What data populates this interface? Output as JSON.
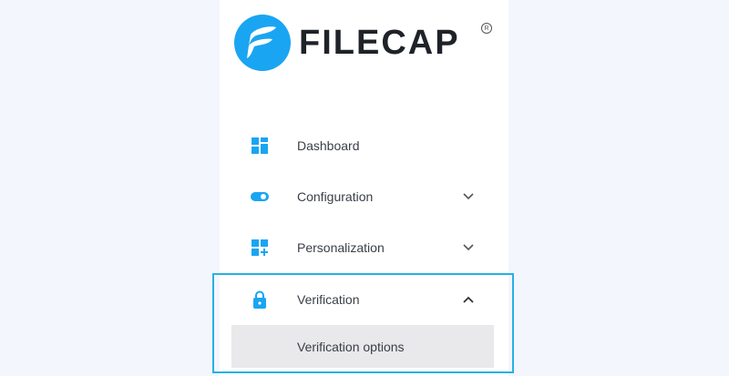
{
  "brand": {
    "name": "FILECAP",
    "registered": "R",
    "accent": "#1aa5f2"
  },
  "sidebar": {
    "items": [
      {
        "label": "Dashboard",
        "icon": "dashboard-icon"
      },
      {
        "label": "Configuration",
        "icon": "toggle-icon",
        "chevron": "chevron-down-icon"
      },
      {
        "label": "Personalization",
        "icon": "add-widget-icon",
        "chevron": "chevron-down-icon"
      },
      {
        "label": "Verification",
        "icon": "lock-icon",
        "chevron": "chevron-up-icon",
        "expanded": true,
        "children": [
          {
            "label": "Verification options"
          }
        ]
      }
    ]
  }
}
